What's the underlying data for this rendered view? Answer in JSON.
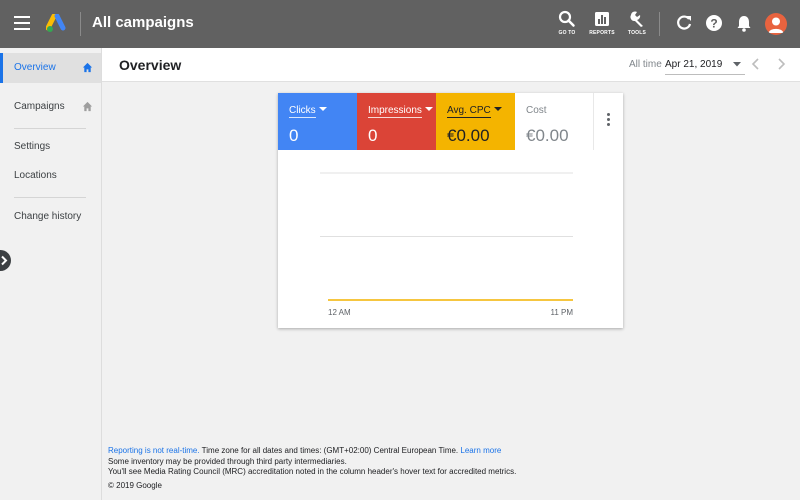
{
  "topbar": {
    "title": "All campaigns",
    "goto_label": "GO TO",
    "reports_label": "REPORTS",
    "tools_label": "TOOLS"
  },
  "sidebar": {
    "items": [
      {
        "label": "Overview"
      },
      {
        "label": "Campaigns"
      },
      {
        "label": "Settings"
      },
      {
        "label": "Locations"
      },
      {
        "label": "Change history"
      }
    ]
  },
  "header": {
    "title": "Overview",
    "range_label": "All time",
    "range_value": "Apr 21, 2019"
  },
  "metrics": [
    {
      "label": "Clicks",
      "value": "0",
      "color": "#4285f4"
    },
    {
      "label": "Impressions",
      "value": "0",
      "color": "#db4437"
    },
    {
      "label": "Avg. CPC",
      "value": "€0.00",
      "color": "#f4b400"
    },
    {
      "label": "Cost",
      "value": "€0.00"
    }
  ],
  "chart_data": {
    "type": "line",
    "x": [
      "12 AM",
      "11 PM"
    ],
    "series": [
      {
        "values": [
          0,
          0
        ],
        "color": "#f4b400"
      }
    ],
    "tick_labels": [
      "12 AM",
      "11 PM"
    ],
    "grid": true
  },
  "footer": {
    "realtime_link": "Reporting is not real-time.",
    "timezone_text": " Time zone for all dates and times: (GMT+02:00) Central European Time. ",
    "learn_more": "Learn more",
    "line2": "Some inventory may be provided through third party intermediaries.",
    "line3": "You'll see Media Rating Council (MRC) accreditation noted in the column header's hover text for accredited metrics.",
    "copyright": "© 2019 Google"
  }
}
